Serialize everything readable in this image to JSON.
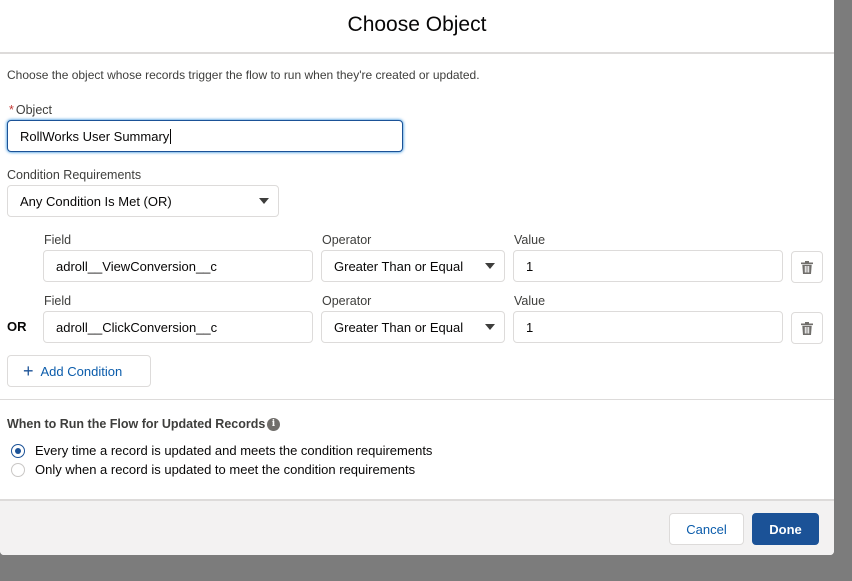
{
  "modal": {
    "title": "Choose Object",
    "description": "Choose the object whose records trigger the flow to run when they're created or updated."
  },
  "object": {
    "required_mark": "*",
    "label": "Object",
    "value": "RollWorks User Summary"
  },
  "condition_requirements": {
    "label": "Condition Requirements",
    "selected": "Any Condition Is Met (OR)"
  },
  "conditions": [
    {
      "prefix": "",
      "field_label": "Field",
      "field_value": "adroll__ViewConversion__c",
      "operator_label": "Operator",
      "operator_value": "Greater Than or Equal",
      "value_label": "Value",
      "value": "1"
    },
    {
      "prefix": "OR",
      "field_label": "Field",
      "field_value": "adroll__ClickConversion__c",
      "operator_label": "Operator",
      "operator_value": "Greater Than or Equal",
      "value_label": "Value",
      "value": "1"
    }
  ],
  "add_condition": {
    "label": "Add Condition",
    "icon": "plus-icon"
  },
  "run_section": {
    "title": "When to Run the Flow for Updated Records",
    "info_icon": "info-icon",
    "options": [
      {
        "label": "Every time a record is updated and meets the condition requirements",
        "selected": true
      },
      {
        "label": "Only when a record is updated to meet the condition requirements",
        "selected": false
      }
    ]
  },
  "footer": {
    "cancel_label": "Cancel",
    "done_label": "Done"
  },
  "colors": {
    "brand": "#1b5297",
    "required": "#c23934",
    "link": "#0b5cab",
    "overlay": "#7c7c7c"
  }
}
